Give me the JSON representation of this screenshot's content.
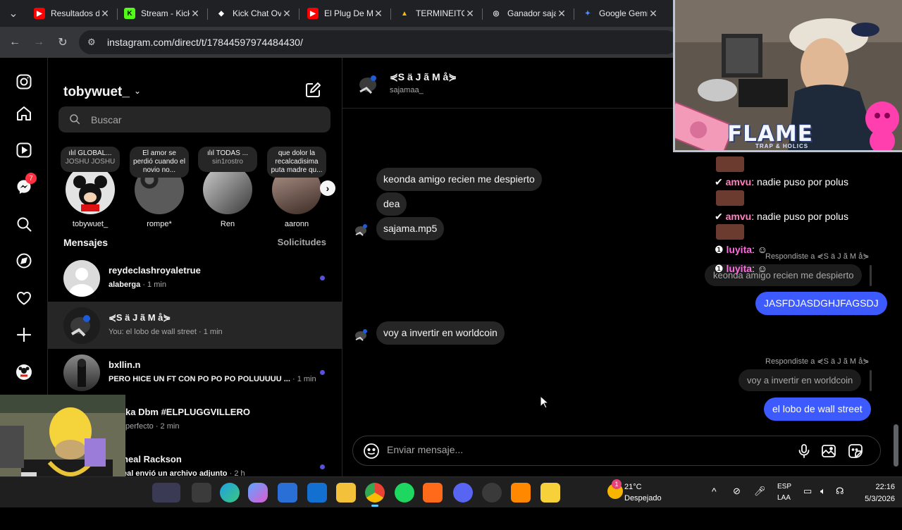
{
  "browser": {
    "tabs": [
      {
        "title": "Resultados de",
        "color": "#ff0000",
        "glyph": "▶"
      },
      {
        "title": "Stream - Kick",
        "color": "#53fc18",
        "glyph": "K"
      },
      {
        "title": "Kick Chat Ove",
        "color": "#ffffff",
        "glyph": "◆"
      },
      {
        "title": "El Plug De Ma",
        "color": "#ff0000",
        "glyph": "▶"
      },
      {
        "title": "TERMINEITO",
        "color": "#1fa463",
        "glyph": "▲"
      },
      {
        "title": "Ganador saja",
        "color": "#e8eaed",
        "glyph": "◎"
      },
      {
        "title": "Google Gemi",
        "color": "#4f8df9",
        "glyph": "✦"
      }
    ],
    "url": "instagram.com/direct/t/17844597974484430/"
  },
  "instagram": {
    "rail_badge": "7",
    "account": "tobywuet_",
    "search_placeholder": "Buscar",
    "notes": [
      {
        "text": "ılıl GLOBAL...",
        "sub": "JOSHU JOSHU",
        "name": "tobywuet_",
        "color": "#e3e3e3"
      },
      {
        "text": "El amor se perdió cuando el novio no...",
        "sub": "",
        "name": "rompe*",
        "color": "#3a3a3a"
      },
      {
        "text": "ılıl TODAS ...",
        "sub": "sin1rostro",
        "name": "Ren",
        "color": "#8a8a8a"
      },
      {
        "text": "que dolor la recalcadisima puta madre qu...",
        "sub": "",
        "name": "aaronn",
        "color": "#7a5b52"
      }
    ],
    "messages_header": "Mensajes",
    "requests_label": "Solicitudes",
    "threads": [
      {
        "name": "reydeclashroyaletrue",
        "preview": "alaberga",
        "time": "· 1 min",
        "unread": true,
        "active": false
      },
      {
        "name": "⋞S ä J ã M å⋟",
        "preview": "You: el lobo de wall street",
        "time": "· 1 min",
        "unread": false,
        "active": true
      },
      {
        "name": "bxllin.n",
        "preview": "PERO HICE UN FT CON PO PO PO POLUUUUU ...",
        "time": "· 1 min",
        "unread": true,
        "active": false
      },
      {
        "name": "ka Dbm #ELPLUGGVILLERO",
        "preview": "perfecto",
        "time": "· 2 min",
        "unread": false,
        "active": false
      },
      {
        "name": "neal Rackson",
        "preview": "eal envió un archivo adjunto",
        "time": "· 2 h",
        "unread": true,
        "active": false
      }
    ],
    "chat": {
      "title": "⋞S ä J ã M å⋟",
      "username": "sajamaa_",
      "incoming": [
        "keonda amigo recien me despierto",
        "dea",
        "sajama.mp5",
        "voy a invertir en worldcoin"
      ],
      "reply1_label": "Respondiste a ⋞S ä J ã M å⋟",
      "reply1_quote": "keonda amigo recien me despierto",
      "out1": "JASFDJASDGHJFAGSDJ",
      "reply2_label": "Respondiste a ⋞S ä J ã M å⋟",
      "reply2_quote": "voy a invertir en worldcoin",
      "out2": "el lobo de wall street",
      "composer_placeholder": "Enviar mensaje..."
    }
  },
  "overlay": {
    "flame_title": "FLAME",
    "flame_sub": "TRAP & HOLICS",
    "chat_lines": [
      {
        "user": "amvu",
        "text": ": nadie puso por polus"
      },
      {
        "user": "amvu",
        "text": ": nadie puso por polus"
      },
      {
        "user": "luyita",
        "text": ":"
      },
      {
        "user": "luyita",
        "text": ":"
      }
    ]
  },
  "taskbar": {
    "weather_temp": "21°C",
    "weather_desc": "Despejado",
    "weather_badge": "1",
    "lang_top": "ESP",
    "lang_bottom": "LAA",
    "time": "22:16",
    "date": "5/3/2026"
  }
}
